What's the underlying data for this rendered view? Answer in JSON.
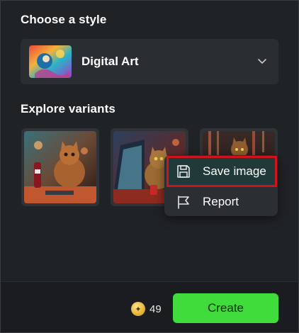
{
  "style_section": {
    "title": "Choose a style",
    "selected_style": "Digital Art"
  },
  "variants_section": {
    "title": "Explore variants",
    "variants": [
      {
        "name": "variant-1"
      },
      {
        "name": "variant-2"
      },
      {
        "name": "variant-3"
      }
    ]
  },
  "context_menu": {
    "items": [
      {
        "label": "Save image",
        "icon": "save-icon",
        "highlighted": true
      },
      {
        "label": "Report",
        "icon": "flag-icon",
        "highlighted": false
      }
    ]
  },
  "footer": {
    "credits": "49",
    "create_label": "Create"
  },
  "colors": {
    "accent_green": "#3fdc3c",
    "highlight_outline": "#d0121c",
    "panel_bg": "#202326"
  }
}
